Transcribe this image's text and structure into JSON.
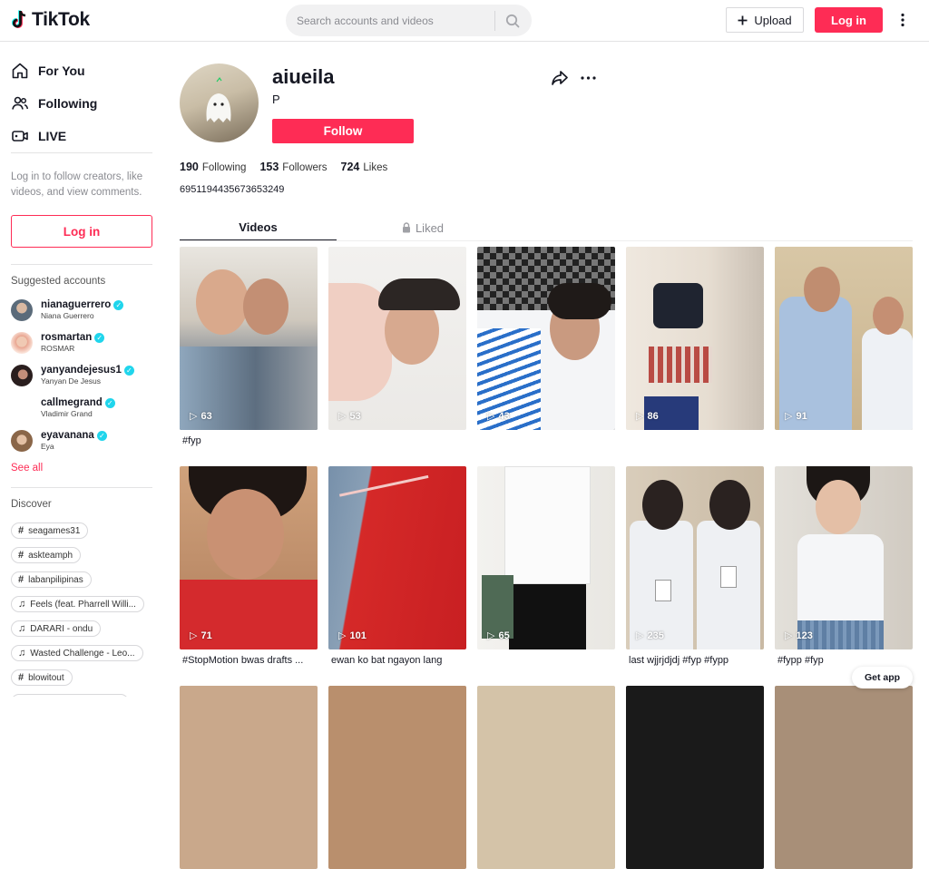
{
  "header": {
    "logo_text": "TikTok",
    "search_placeholder": "Search accounts and videos",
    "upload_label": "Upload",
    "login_label": "Log in"
  },
  "sidebar": {
    "nav": [
      {
        "label": "For You",
        "icon": "home-icon"
      },
      {
        "label": "Following",
        "icon": "people-icon"
      },
      {
        "label": "LIVE",
        "icon": "live-icon"
      }
    ],
    "login_hint": "Log in to follow creators, like videos, and view comments.",
    "login_label": "Log in",
    "suggested_title": "Suggested accounts",
    "accounts": [
      {
        "username": "nianaguerrero",
        "name": "Niana Guerrero",
        "color": "#5b6b7a"
      },
      {
        "username": "rosmartan",
        "name": "ROSMAR",
        "color": "#e8b8a8"
      },
      {
        "username": "yanyandejesus1",
        "name": "Yanyan De Jesus",
        "color": "#3a2a2a"
      },
      {
        "username": "callmegrand",
        "name": "Vladimir Grand",
        "color": "#ffffff"
      },
      {
        "username": "eyavanana",
        "name": "Eya",
        "color": "#a37b5c"
      }
    ],
    "see_all": "See all",
    "discover_title": "Discover",
    "discover": [
      {
        "type": "hashtag",
        "label": "seagames31"
      },
      {
        "type": "hashtag",
        "label": "askteamph"
      },
      {
        "type": "hashtag",
        "label": "labanpilipinas"
      },
      {
        "type": "music",
        "label": "Feels (feat. Pharrell Willi..."
      },
      {
        "type": "music",
        "label": "DARARI - ondu"
      },
      {
        "type": "music",
        "label": "Wasted Challenge - Leo..."
      },
      {
        "type": "hashtag",
        "label": "blowitout"
      }
    ]
  },
  "profile": {
    "username": "aiueila",
    "nickname": "P",
    "follow_label": "Follow",
    "stats": [
      {
        "value": "190",
        "label": "Following"
      },
      {
        "value": "153",
        "label": "Followers"
      },
      {
        "value": "724",
        "label": "Likes"
      }
    ],
    "bio": "6951194435673653249",
    "tabs": {
      "videos": "Videos",
      "liked": "Liked"
    }
  },
  "videos": [
    {
      "views": "63",
      "caption": "#fyp"
    },
    {
      "views": "53",
      "caption": ""
    },
    {
      "views": "43",
      "caption": ""
    },
    {
      "views": "86",
      "caption": ""
    },
    {
      "views": "91",
      "caption": ""
    },
    {
      "views": "71",
      "caption": "#StopMotion bwas drafts ..."
    },
    {
      "views": "101",
      "caption": "ewan ko bat ngayon lang"
    },
    {
      "views": "65",
      "caption": ""
    },
    {
      "views": "235",
      "caption": "last wjjrjdjdj #fyp #fypp"
    },
    {
      "views": "123",
      "caption": "#fypp #fyp"
    }
  ],
  "get_app": "Get app",
  "colors": {
    "brand": "#fe2c55",
    "verified": "#20d5ec"
  }
}
